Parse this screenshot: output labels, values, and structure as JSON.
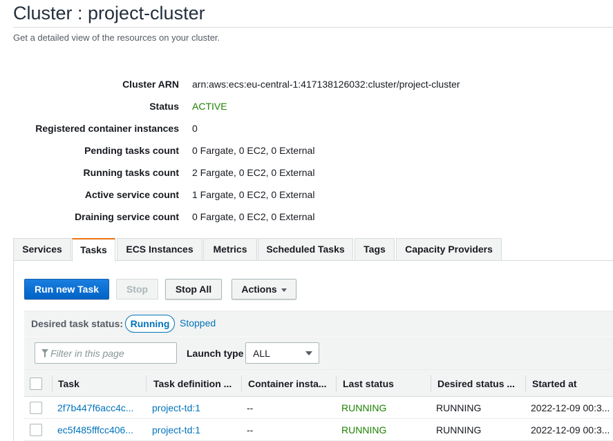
{
  "header": {
    "title": "Cluster : project-cluster",
    "subtitle": "Get a detailed view of the resources on your cluster."
  },
  "details": [
    {
      "label": "Cluster ARN",
      "value": "arn:aws:ecs:eu-central-1:417138126032:cluster/project-cluster"
    },
    {
      "label": "Status",
      "value": "ACTIVE"
    },
    {
      "label": "Registered container instances",
      "value": "0"
    },
    {
      "label": "Pending tasks count",
      "value": "0 Fargate, 0 EC2, 0 External"
    },
    {
      "label": "Running tasks count",
      "value": "2 Fargate, 0 EC2, 0 External"
    },
    {
      "label": "Active service count",
      "value": "1 Fargate, 0 EC2, 0 External"
    },
    {
      "label": "Draining service count",
      "value": "0 Fargate, 0 EC2, 0 External"
    }
  ],
  "colors": {
    "active_status": "#1d8102",
    "link": "#0073bb",
    "primary_button": "#0972d3",
    "selected_tab_accent": "#ec7211"
  },
  "tabs": [
    {
      "label": "Services"
    },
    {
      "label": "Tasks"
    },
    {
      "label": "ECS Instances"
    },
    {
      "label": "Metrics"
    },
    {
      "label": "Scheduled Tasks"
    },
    {
      "label": "Tags"
    },
    {
      "label": "Capacity Providers"
    }
  ],
  "selected_tab": "Tasks",
  "toolbar": {
    "run_new_task": "Run new Task",
    "stop": "Stop",
    "stop_all": "Stop All",
    "actions": "Actions"
  },
  "desired_status": {
    "label": "Desired task status:",
    "running": "Running",
    "stopped": "Stopped",
    "selected": "Running"
  },
  "filter": {
    "placeholder": "Filter in this page",
    "launch_type_label": "Launch type",
    "launch_type_value": "ALL"
  },
  "table": {
    "columns": [
      "Task",
      "Task definition ...",
      "Container insta...",
      "Last status",
      "Desired status ...",
      "Started at"
    ],
    "rows": [
      {
        "task": "2f7b447f6acc4c...",
        "task_definition": "project-td:1",
        "container_instance": "--",
        "last_status": "RUNNING",
        "desired_status": "RUNNING",
        "started_at": "2022-12-09 00:3..."
      },
      {
        "task": "ec5f485fffcc406...",
        "task_definition": "project-td:1",
        "container_instance": "--",
        "last_status": "RUNNING",
        "desired_status": "RUNNING",
        "started_at": "2022-12-09 00:3..."
      }
    ]
  }
}
